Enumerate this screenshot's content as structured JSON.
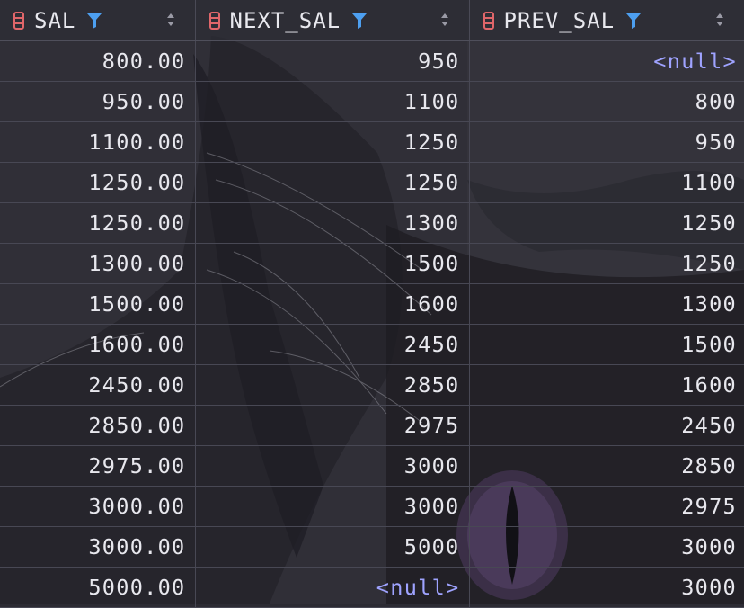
{
  "grid": {
    "columns": [
      {
        "name": "SAL"
      },
      {
        "name": "NEXT_SAL"
      },
      {
        "name": "PREV_SAL"
      }
    ],
    "rows": [
      [
        "800.00",
        "950",
        "<null>"
      ],
      [
        "950.00",
        "1100",
        "800"
      ],
      [
        "1100.00",
        "1250",
        "950"
      ],
      [
        "1250.00",
        "1250",
        "1100"
      ],
      [
        "1250.00",
        "1300",
        "1250"
      ],
      [
        "1300.00",
        "1500",
        "1250"
      ],
      [
        "1500.00",
        "1600",
        "1300"
      ],
      [
        "1600.00",
        "2450",
        "1500"
      ],
      [
        "2450.00",
        "2850",
        "1600"
      ],
      [
        "2850.00",
        "2975",
        "2450"
      ],
      [
        "2975.00",
        "3000",
        "2850"
      ],
      [
        "3000.00",
        "3000",
        "2975"
      ],
      [
        "3000.00",
        "5000",
        "3000"
      ],
      [
        "5000.00",
        "<null>",
        "3000"
      ]
    ]
  },
  "icons": {
    "column": "column-icon",
    "filter": "filter-icon",
    "sort": "sort-arrows-icon"
  },
  "colors": {
    "column_icon": "#e0666a",
    "filter_icon": "#4d9ff0",
    "null_text": "#9fa3ff",
    "text": "#e8e8ee"
  }
}
